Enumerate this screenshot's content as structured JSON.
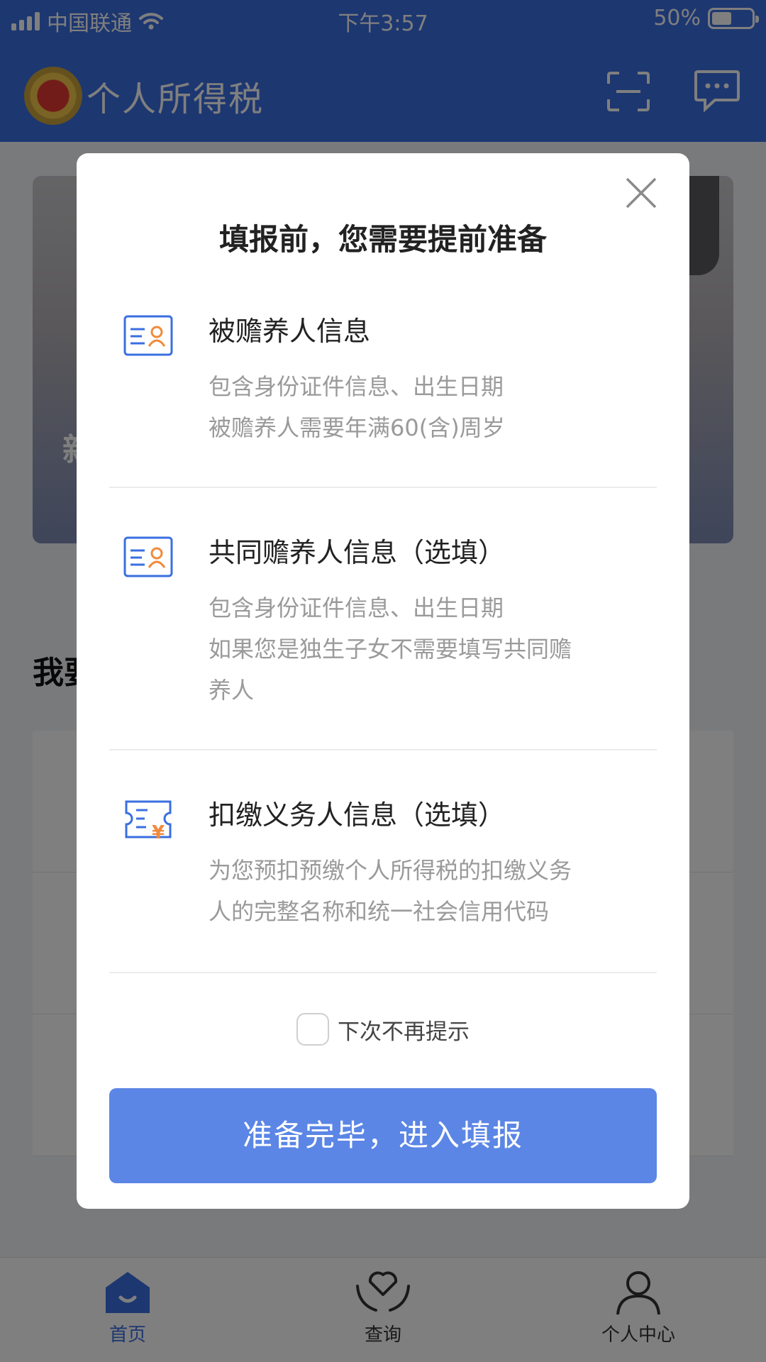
{
  "status_bar": {
    "carrier": "中国联通",
    "time": "下午3:57",
    "battery_percent_label": "50%",
    "battery_level": 0.5
  },
  "header": {
    "title": "个人所得税",
    "scan_icon": "scan-icon",
    "message_icon": "chat-icon"
  },
  "background": {
    "banner_text_partial": "新",
    "section_title_partial": "我要"
  },
  "modal": {
    "title": "填报前，您需要提前准备",
    "items": [
      {
        "icon": "id-card-icon",
        "heading": "被赡养人信息",
        "desc_lines": [
          "包含身份证件信息、出生日期",
          "被赡养人需要年满60(含)周岁"
        ]
      },
      {
        "icon": "id-card-icon",
        "heading": "共同赡养人信息（选填）",
        "desc_lines": [
          "包含身份证件信息、出生日期",
          "如果您是独生子女不需要填写共同赡",
          "养人"
        ]
      },
      {
        "icon": "ticket-yuan-icon",
        "heading": "扣缴义务人信息（选填）",
        "desc_lines": [
          "为您预扣预缴个人所得税的扣缴义务",
          "人的完整名称和统一社会信用代码"
        ]
      }
    ],
    "dont_remind_label": "下次不再提示",
    "dont_remind_checked": false,
    "confirm_button": "准备完毕，进入填报"
  },
  "tab_bar": {
    "tabs": [
      {
        "label": "首页",
        "icon": "home-icon",
        "active": true
      },
      {
        "label": "查询",
        "icon": "heart-hands-icon",
        "active": false
      },
      {
        "label": "个人中心",
        "icon": "person-icon",
        "active": false
      }
    ]
  },
  "colors": {
    "brand_blue": "#3a6fe0",
    "button_blue": "#5b86e5",
    "icon_orange": "#f08a3c"
  }
}
